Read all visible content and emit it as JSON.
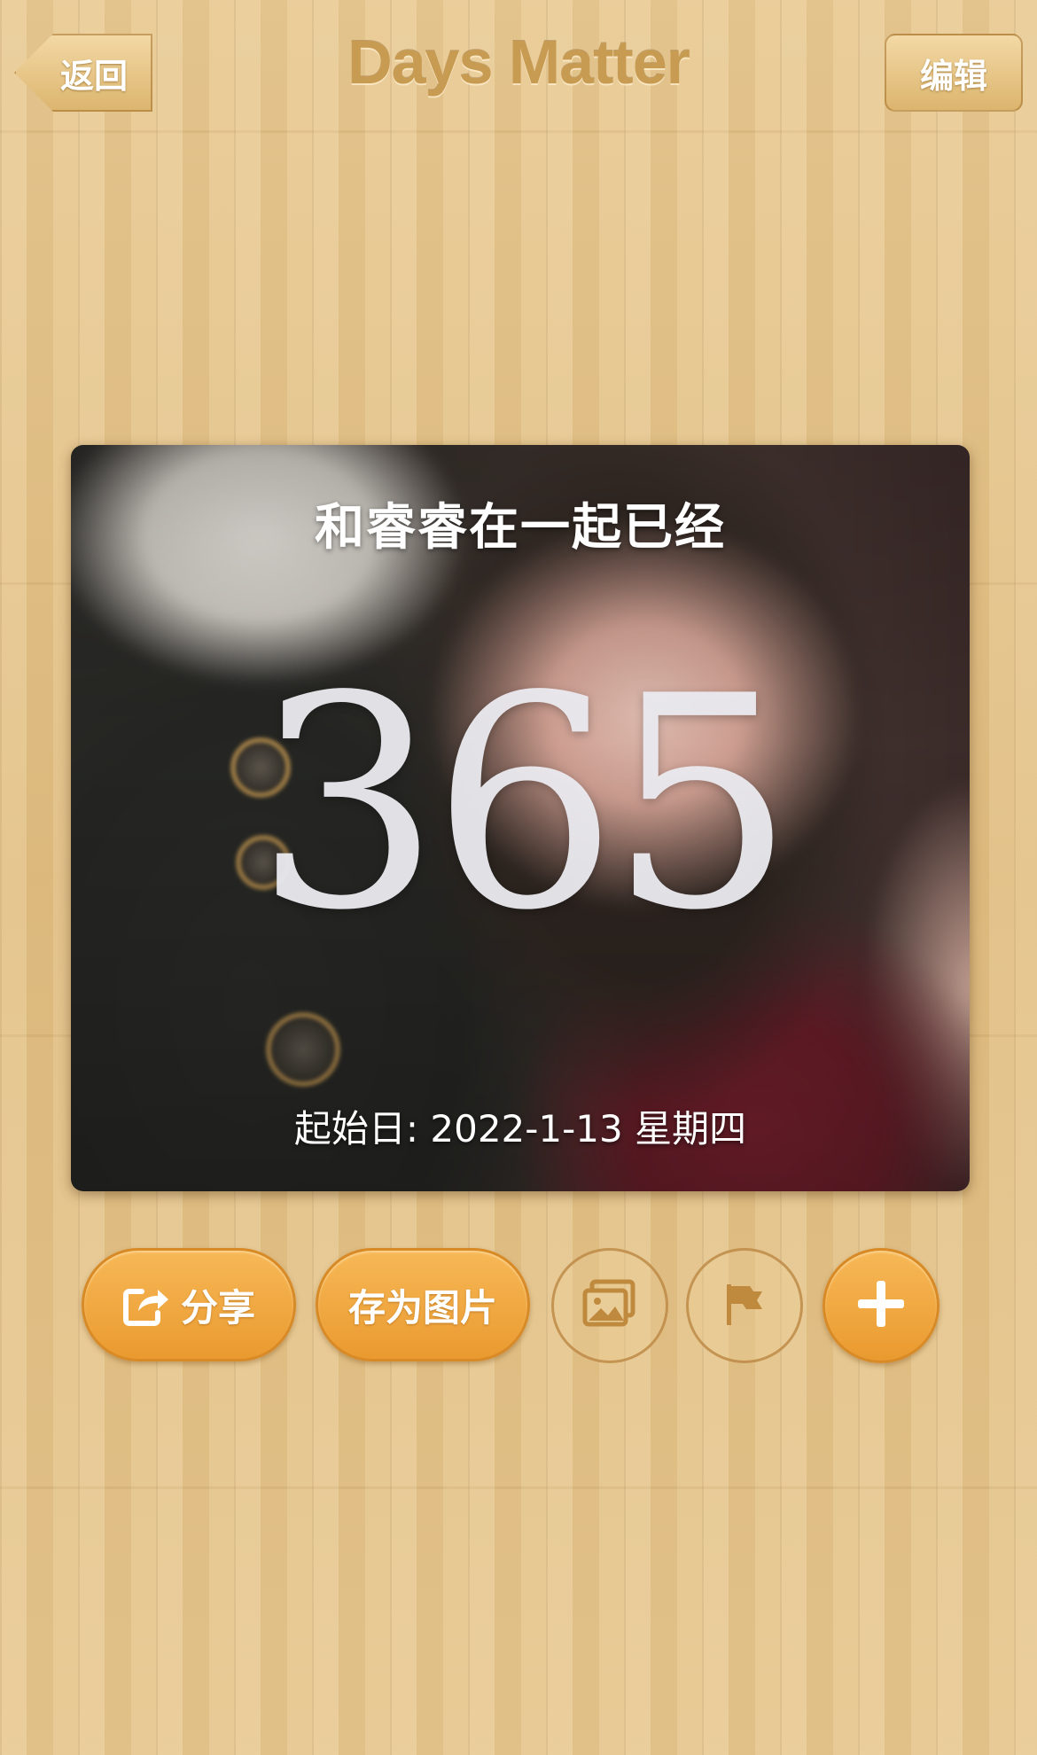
{
  "nav": {
    "back_label": "返回",
    "title": "Days Matter",
    "edit_label": "编辑"
  },
  "card": {
    "caption": "和睿睿在一起已经",
    "days": "365",
    "start_label": "起始日: 2022-1-13 星期四"
  },
  "actions": {
    "share_label": "分享",
    "save_image_label": "存为图片",
    "icons": [
      "share-icon",
      "image-icon",
      "flag-icon",
      "plus-icon"
    ]
  },
  "colors": {
    "wood": "#e3c48c",
    "title": "#c89b52",
    "accent_orange": "#f0a83e",
    "outline_brown": "#b8823c"
  }
}
